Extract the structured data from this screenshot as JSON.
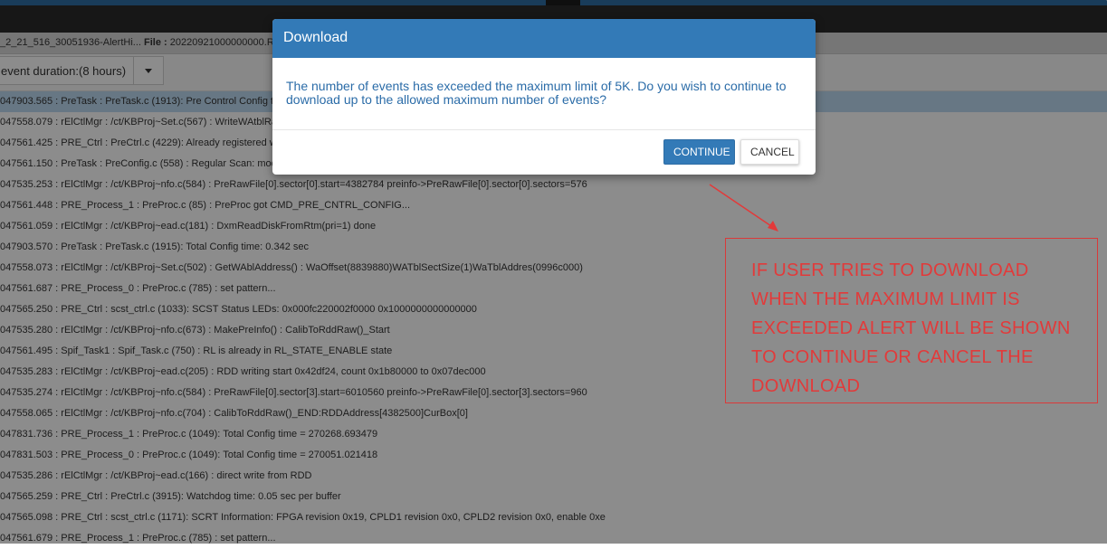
{
  "filebar": {
    "name_text": "_2_21_516_30051936-AlertHi...",
    "file_label": "File :",
    "file_value": "20220921000000000.R"
  },
  "toolbar": {
    "duration_select": "event duration:(8 hours)"
  },
  "log_rows": [
    "047903.565 : PreTask : PreTask.c (1913): Pre Control Config t",
    "047558.079 : rElCtlMgr : /ct/KBProj~Set.c(567) : WriteWAtblRa",
    "047561.425 : PRE_Ctrl : PreCtrl.c (4229): Already registered w",
    "047561.150 : PreTask : PreConfig.c (558) : Regular Scan: mod",
    "047535.253 : rElCtlMgr : /ct/KBProj~nfo.c(584) : PreRawFile[0].sector[0].start=4382784 preinfo->PreRawFile[0].sector[0].sectors=576",
    "047561.448 : PRE_Process_1 : PreProc.c (85) : PreProc got CMD_PRE_CNTRL_CONFIG...",
    "047561.059 : rElCtlMgr : /ct/KBProj~ead.c(181) : DxmReadDiskFromRtm(pri=1) done",
    "047903.570 : PreTask : PreTask.c (1915): Total Config time: 0.342 sec",
    "047558.073 : rElCtlMgr : /ct/KBProj~Set.c(502) : GetWAblAddress() : WaOffset(8839880)WATblSectSize(1)WaTblAddres(0996c000)",
    "047561.687 : PRE_Process_0 : PreProc.c (785) : set pattern...",
    "047565.250 : PRE_Ctrl : scst_ctrl.c (1033): SCST Status LEDs: 0x000fc220002f0000 0x1000000000000000",
    "047535.280 : rElCtlMgr : /ct/KBProj~nfo.c(673) : MakePreInfo() : CalibToRddRaw()_Start",
    "047561.495 : Spif_Task1 : Spif_Task.c (750) : RL is already in RL_STATE_ENABLE state",
    "047535.283 : rElCtlMgr : /ct/KBProj~ead.c(205) : RDD writing start 0x42df24, count 0x1b80000 to 0x07dec000",
    "047535.274 : rElCtlMgr : /ct/KBProj~nfo.c(584) : PreRawFile[0].sector[3].start=6010560 preinfo->PreRawFile[0].sector[3].sectors=960",
    "047558.065 : rElCtlMgr : /ct/KBProj~nfo.c(704) : CalibToRddRaw()_END:RDDAddress[4382500]CurBox[0]",
    "047831.736 : PRE_Process_1 : PreProc.c (1049): Total Config time = 270268.693479",
    "047831.503 : PRE_Process_0 : PreProc.c (1049): Total Config time = 270051.021418",
    "047535.286 : rElCtlMgr : /ct/KBProj~ead.c(166) : direct write from RDD",
    "047565.259 : PRE_Ctrl : PreCtrl.c (3915): Watchdog time: 0.05 sec per buffer",
    "047565.098 : PRE_Ctrl : scst_ctrl.c (1171): SCRT Information: FPGA revision 0x19, CPLD1 revision 0x0, CPLD2 revision 0x0, enable 0xe",
    "047561.679 : PRE_Process_1 : PreProc.c (785) : set pattern..."
  ],
  "modal": {
    "title": "Download",
    "message": "The number of events has exceeded the maximum limit of 5K. Do you wish to continue to download up to the allowed maximum number of events?",
    "continue_label": "CONTINUE",
    "cancel_label": "CANCEL"
  },
  "annotation": {
    "lines": [
      "IF USER TRIES TO DOWNLOAD",
      "WHEN THE MAXIMUM LIMIT IS",
      "EXCEEDED ALERT WILL BE SHOWN",
      "TO CONTINUE OR CANCEL THE",
      "DOWNLOAD"
    ],
    "color": "#e23a3a"
  },
  "colors": {
    "accent": "#337ab7",
    "selected_row": "#bcd9f0"
  },
  "icons": {
    "topbar_notch": "chevron-down-icon",
    "dropdown_caret": "caret-down-icon"
  }
}
